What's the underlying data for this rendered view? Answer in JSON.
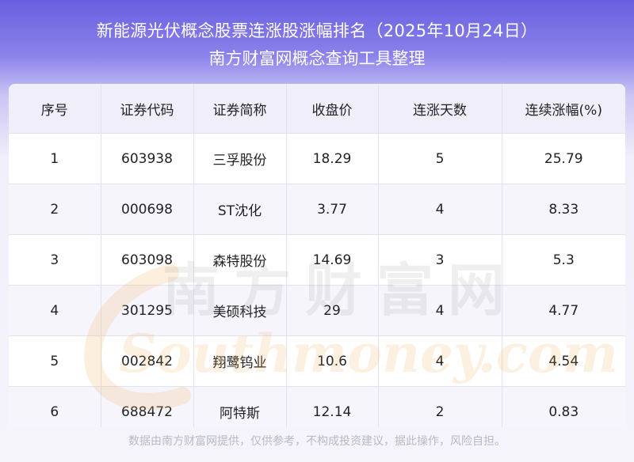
{
  "header": {
    "title_line1": "新能源光伏概念股票连涨股涨幅排名（2025年10月24日）",
    "title_line2": "南方财富网概念查询工具整理"
  },
  "table": {
    "columns": [
      "序号",
      "证券代码",
      "证券简称",
      "收盘价",
      "连涨天数",
      "连续涨幅(%)"
    ],
    "rows": [
      [
        "1",
        "603938",
        "三孚股份",
        "18.29",
        "5",
        "25.79"
      ],
      [
        "2",
        "000698",
        "ST沈化",
        "3.77",
        "4",
        "8.33"
      ],
      [
        "3",
        "603098",
        "森特股份",
        "14.69",
        "3",
        "5.3"
      ],
      [
        "4",
        "301295",
        "美硕科技",
        "29",
        "4",
        "4.77"
      ],
      [
        "5",
        "002842",
        "翔鹭钨业",
        "10.6",
        "4",
        "4.54"
      ],
      [
        "6",
        "688472",
        "阿特斯",
        "12.14",
        "2",
        "0.83"
      ]
    ]
  },
  "watermark": {
    "cn": "南方财富网",
    "en": "Southmoney.com"
  },
  "footer": {
    "text": "数据由南方财富网提供，仅供参考，不构成投资建议，据此操作，风险自担。"
  }
}
